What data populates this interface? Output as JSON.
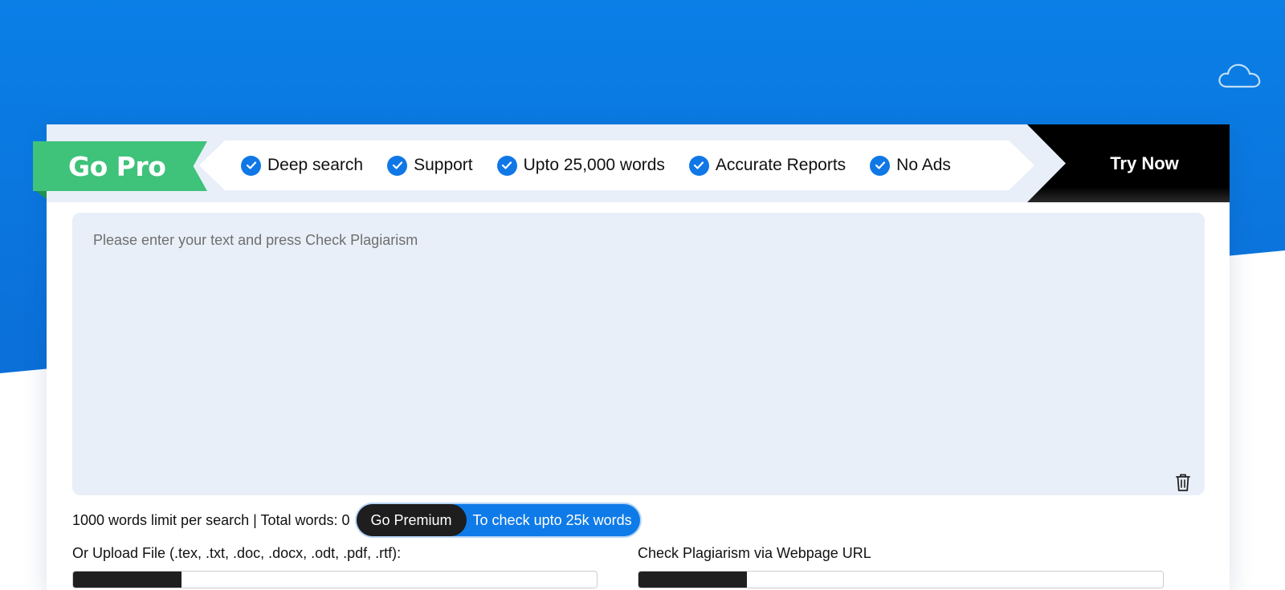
{
  "promo": {
    "badge": "Go Pro",
    "features": [
      "Deep search",
      "Support",
      "Upto 25,000 words",
      "Accurate Reports",
      "No Ads"
    ],
    "cta": "Try Now"
  },
  "editor": {
    "placeholder": "Please enter your text and press Check Plagiarism",
    "value": ""
  },
  "stats": {
    "text": "1000 words limit per search | Total words: 0"
  },
  "premium": {
    "button": "Go Premium",
    "note": "To check upto 25k words"
  },
  "upload": {
    "label": "Or Upload File (.tex, .txt, .doc, .docx, .odt, .pdf, .rtf):"
  },
  "url_check": {
    "label": "Check Plagiarism via Webpage URL"
  },
  "colors": {
    "brand_blue": "#0a7fe6",
    "pro_green": "#3fc27a",
    "panel_bg": "#e8eff8",
    "cta_black": "#000000"
  },
  "icons": [
    "cloud-icon",
    "check-icon",
    "trash-icon"
  ]
}
